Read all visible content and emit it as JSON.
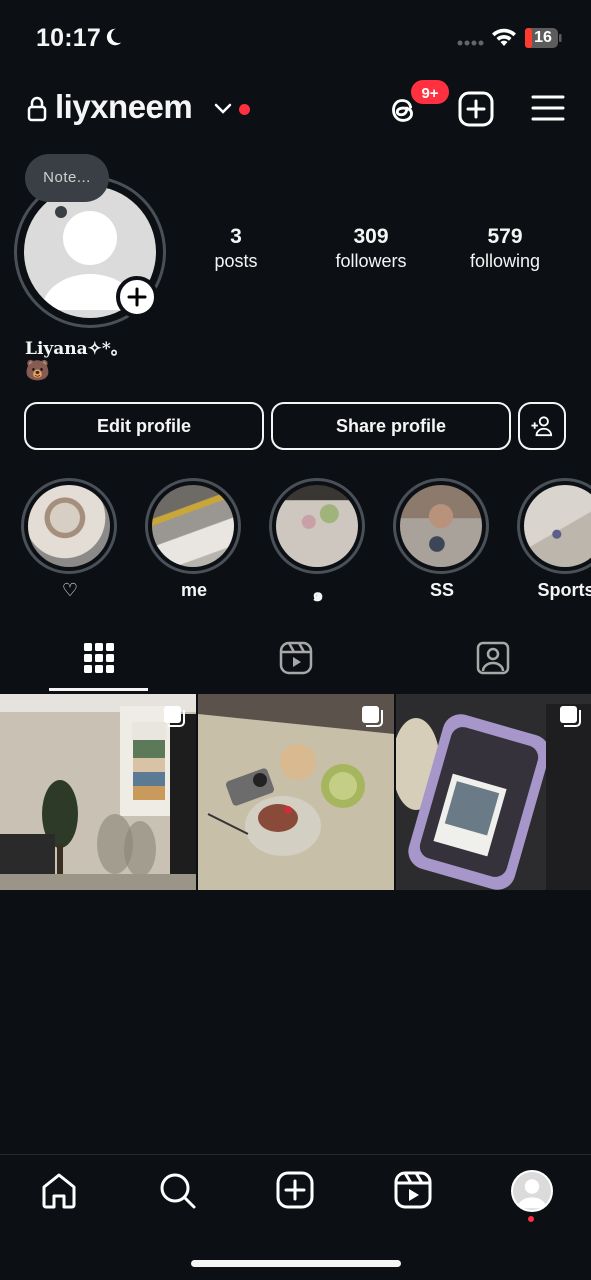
{
  "status_bar": {
    "time": "10:17",
    "battery_level": "16",
    "icons": [
      "moon-icon",
      "signal-icon",
      "wifi-icon",
      "battery-icon"
    ]
  },
  "header": {
    "username": "liyxneem",
    "notification_badge": "9+",
    "icons": [
      "lock-icon",
      "chevron-down-icon",
      "threads-icon",
      "create-icon",
      "menu-icon"
    ]
  },
  "profile": {
    "note_text": "Note...",
    "display_name": "Liyana✧*｡",
    "bio": "🐻",
    "stats": [
      {
        "value": "3",
        "label": "posts"
      },
      {
        "value": "309",
        "label": "followers"
      },
      {
        "value": "579",
        "label": "following"
      }
    ]
  },
  "actions": {
    "edit_profile": "Edit profile",
    "share_profile": "Share profile"
  },
  "highlights": [
    {
      "label": "♡"
    },
    {
      "label": "me"
    },
    {
      "label": "๑"
    },
    {
      "label": "SS"
    },
    {
      "label": "Sports"
    }
  ],
  "tabs": [
    "grid-tab",
    "reels-tab",
    "tagged-tab"
  ],
  "posts_count": 3,
  "bottom_nav": [
    "home-icon",
    "search-icon",
    "create-icon",
    "reels-icon",
    "profile-icon"
  ],
  "colors": {
    "background": "#0c1014",
    "text": "#f5f5f5",
    "notification_red": "#ff3040",
    "ring_gray": "#4a5058"
  }
}
